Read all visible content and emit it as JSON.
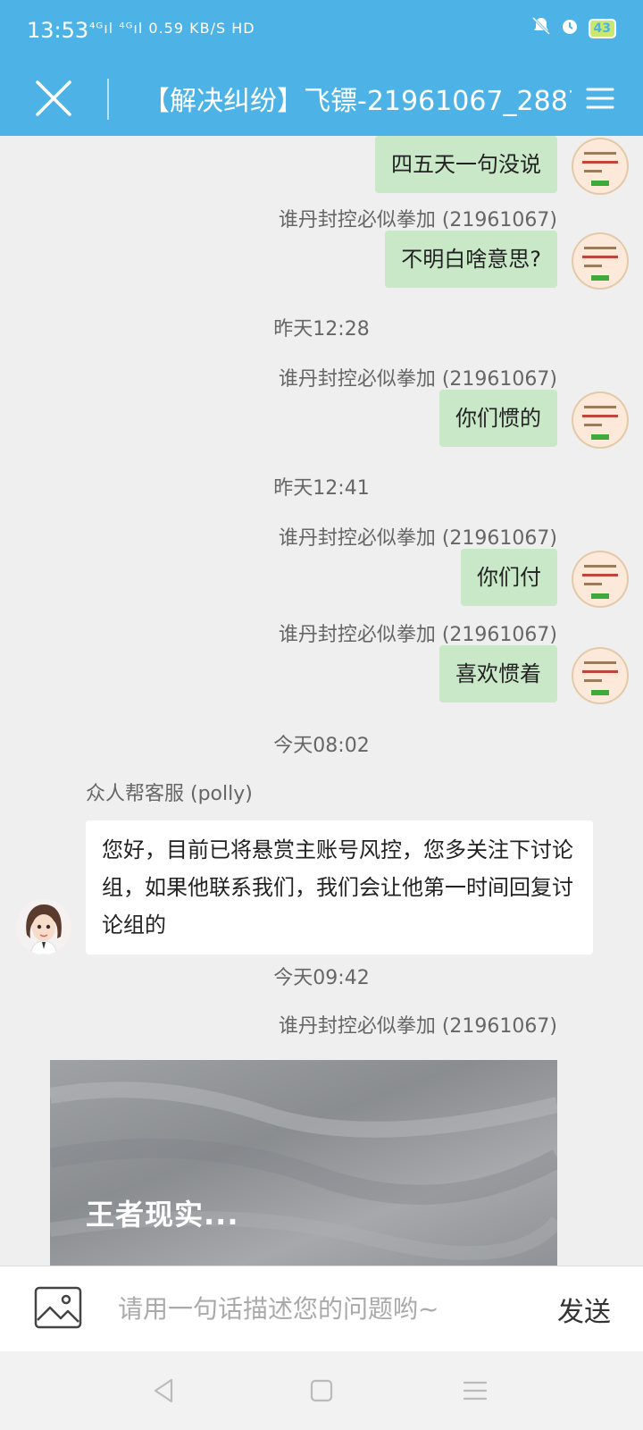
{
  "status_bar": {
    "time": "13:53",
    "network": "⁴ᴳıl ⁴ᴳıl 0.59 KB/S HD",
    "battery": "43"
  },
  "header": {
    "title": "【解决纠纷】飞镖-21961067_2887..."
  },
  "messages": {
    "m1": {
      "text": "四五天一句没说"
    },
    "m2": {
      "sender": "谁丹封控必似拳加 (21961067)",
      "text": "不明白啥意思?"
    },
    "ts1": "昨天12:28",
    "m3": {
      "sender": "谁丹封控必似拳加 (21961067)",
      "text": "你们惯的"
    },
    "ts2": "昨天12:41",
    "m4": {
      "sender": "谁丹封控必似拳加 (21961067)",
      "text": "你们付"
    },
    "m5": {
      "sender": "谁丹封控必似拳加 (21961067)",
      "text": "喜欢惯着"
    },
    "ts3": "今天08:02",
    "m6": {
      "sender": "众人帮客服 (polly)",
      "text": "您好，目前已将悬赏主账号风控，您多关注下讨论组，如果他联系我们，我们会让他第一时间回复讨论组的"
    },
    "ts4": "今天09:42",
    "m7": {
      "sender": "谁丹封控必似拳加 (21961067)",
      "image_caption": "王者现实..."
    }
  },
  "input_bar": {
    "placeholder": "请用一句话描述您的问题哟~",
    "send_label": "发送"
  },
  "colors": {
    "accent": "#4db3e6",
    "bubble_self": "#c9e8c8",
    "bubble_other": "#ffffff"
  }
}
